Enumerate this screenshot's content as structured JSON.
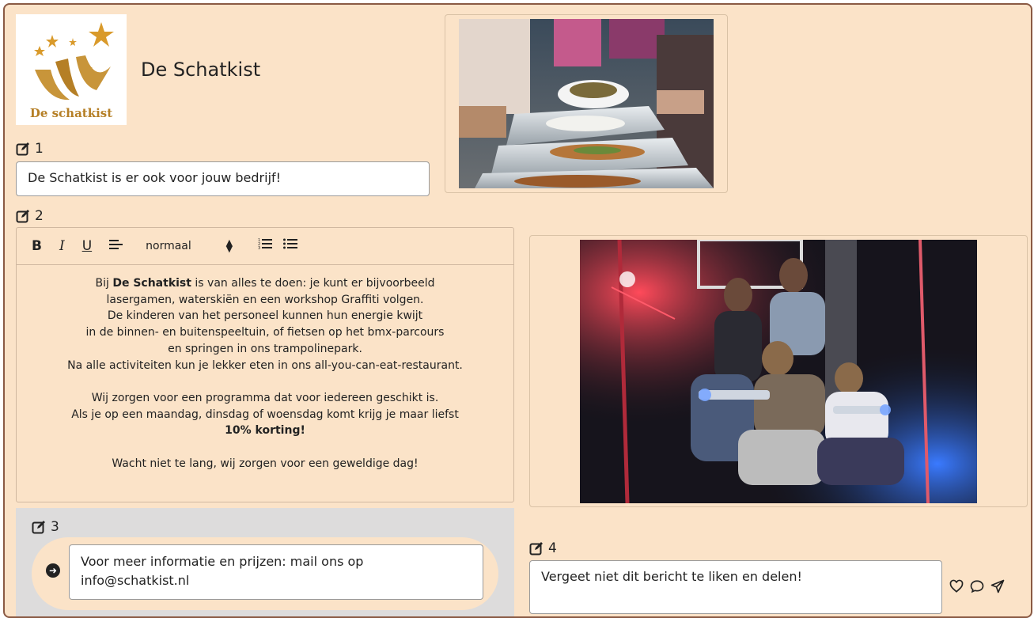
{
  "header": {
    "logo_text": "De schatkist",
    "site_title": "De Schatkist"
  },
  "block1": {
    "number": "1",
    "value": "De Schatkist is er ook voor jouw bedrijf!"
  },
  "block2": {
    "number": "2",
    "toolbar": {
      "bold": "B",
      "italic": "I",
      "underline": "U",
      "font_size": "normaal"
    },
    "paragraphs": [
      {
        "lines": [
          {
            "pre": "Bij ",
            "bold": "De Schatkist",
            "post": " is van alles te doen: je kunt er bijvoorbeeld"
          },
          {
            "text": "lasergamen, waterskiën en een workshop Graffiti volgen."
          },
          {
            "text": "De kinderen van het personeel kunnen hun energie kwijt"
          },
          {
            "text": "in de binnen- en buitenspeeltuin, of fietsen op het bmx-parcours"
          },
          {
            "text": "en springen in ons trampolinepark."
          },
          {
            "text": "Na alle activiteiten kun je lekker eten in ons all-you-can-eat-restaurant."
          }
        ]
      },
      {
        "lines": [
          {
            "text": "Wij zorgen voor een programma dat voor iedereen geschikt is."
          },
          {
            "text": "Als je op een maandag, dinsdag of woensdag komt krijg je maar liefst"
          },
          {
            "bold": "10% korting!"
          }
        ]
      },
      {
        "lines": [
          {
            "text": "Wacht niet te lang, wij zorgen voor een geweldige dag!"
          }
        ]
      }
    ]
  },
  "block3": {
    "number": "3",
    "line1": "Voor meer informatie en prijzen: mail ons op",
    "line2": "info@schatkist.nl"
  },
  "block4": {
    "number": "4",
    "value": "Vergeet niet dit bericht te liken en delen!"
  },
  "icons": {
    "edit": "edit-icon",
    "arrow": "arrow-right-circle-icon",
    "like": "heart-icon",
    "comment": "comment-icon",
    "share": "send-icon"
  },
  "colors": {
    "background": "#fbe3c8",
    "border": "#8a5a44",
    "section3": "#dddcdc",
    "logo_gold": "#c8953a"
  }
}
